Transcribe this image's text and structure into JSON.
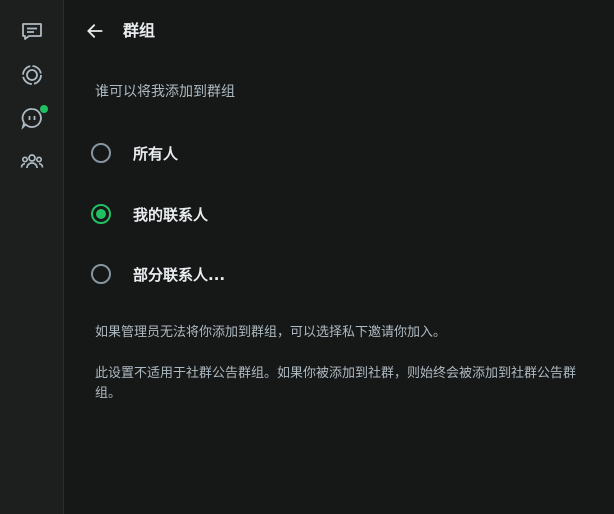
{
  "rail": {
    "items": [
      {
        "name": "chats",
        "icon": "chats-icon"
      },
      {
        "name": "status",
        "icon": "status-icon"
      },
      {
        "name": "channels",
        "icon": "channels-icon",
        "badge_color": "#21c063"
      },
      {
        "name": "communities",
        "icon": "communities-icon"
      }
    ]
  },
  "header": {
    "title": "群组",
    "back_icon": "back-arrow-icon"
  },
  "section": {
    "label": "谁可以将我添加到群组"
  },
  "options": [
    {
      "label": "所有人",
      "selected": false
    },
    {
      "label": "我的联系人",
      "selected": true
    },
    {
      "label": "部分联系人...",
      "selected": false
    }
  ],
  "notes": {
    "first": "如果管理员无法将你添加到群组，可以选择私下邀请你加入。",
    "second": "此设置不适用于社群公告群组。如果你被添加到社群，则始终会被添加到社群公告群组。"
  },
  "colors": {
    "accent": "#21c063",
    "background": "#161717",
    "rail": "#1d1f1f"
  }
}
